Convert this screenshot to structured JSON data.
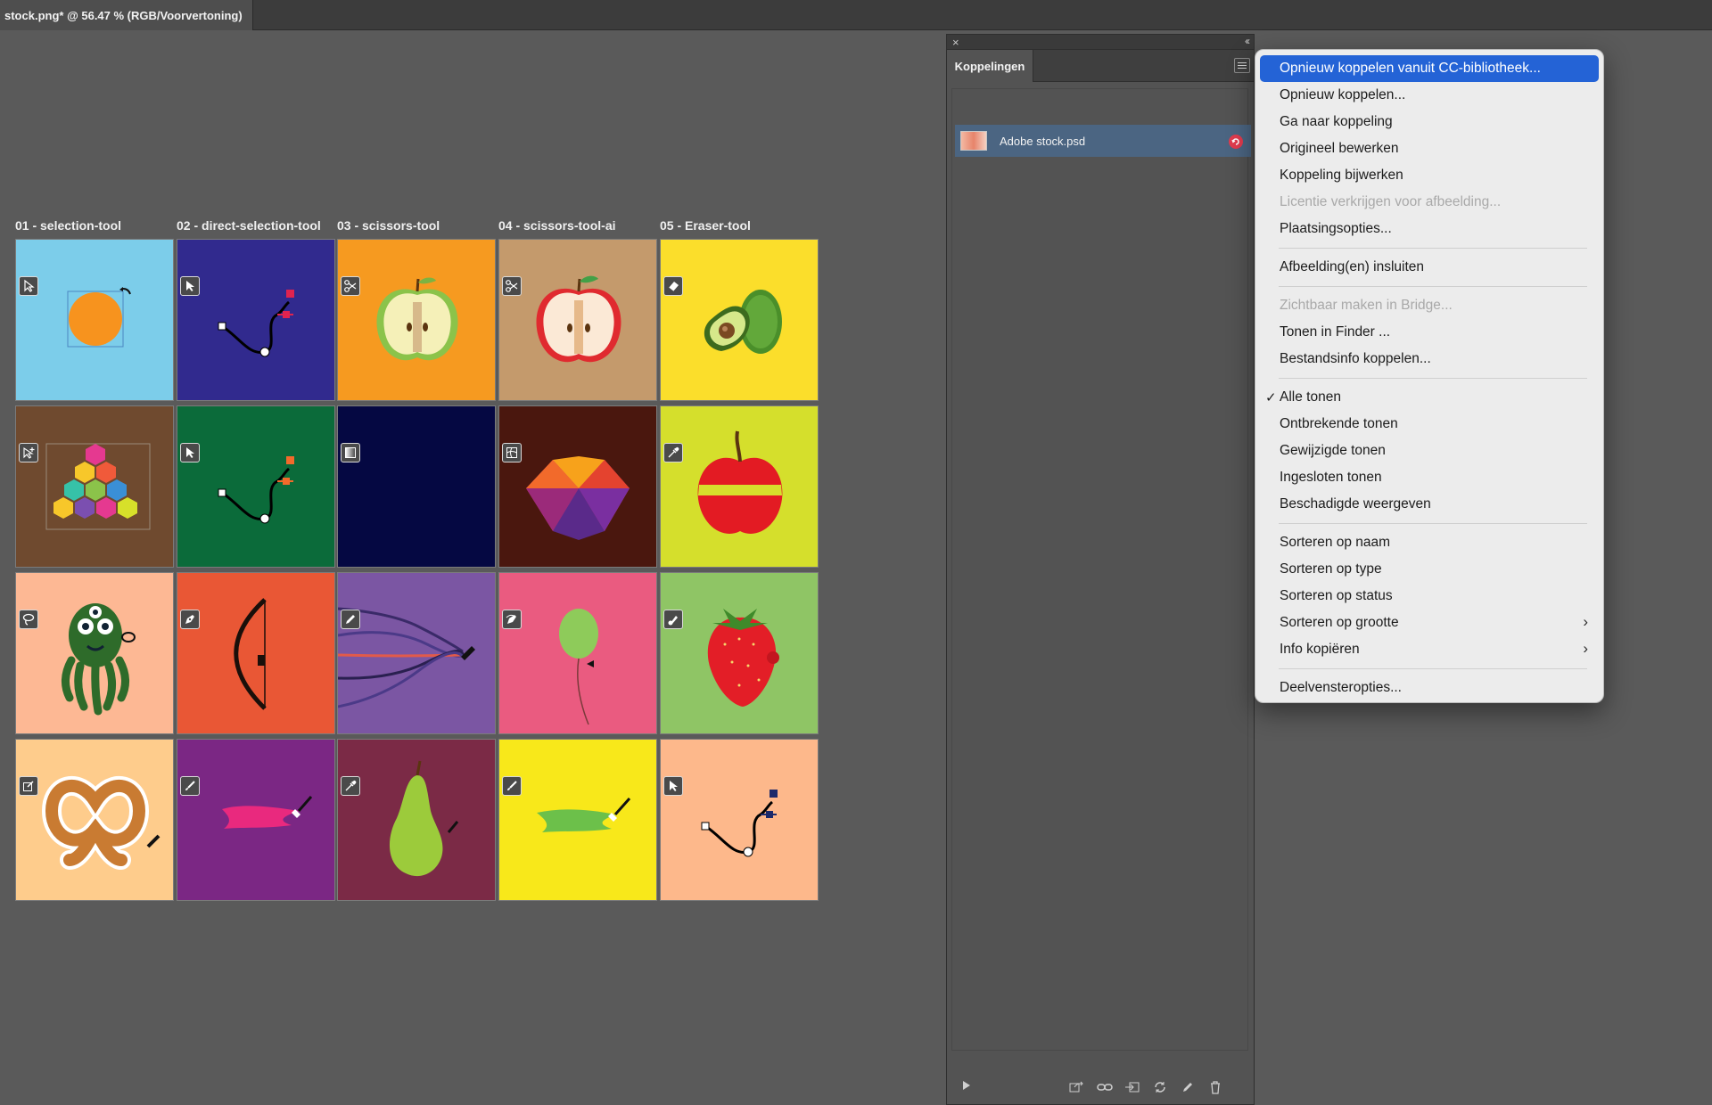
{
  "window": {
    "document_tab_title": "stock.png* @ 56.47 % (RGB/Voorvertoning)"
  },
  "canvas": {
    "column_labels": [
      "01 - selection-tool",
      "02 - direct-selection-tool",
      "03 - scissors-tool",
      "04 - scissors-tool-ai",
      "05 - Eraser-tool"
    ],
    "tile_colors": [
      [
        "#7ccdea",
        "#312a8e",
        "#f69a20",
        "#c49a6c",
        "#fbde2b"
      ],
      [
        "#6f4a2f",
        "#0b6b3a",
        "#050842",
        "#4a170e",
        "#d5df2c"
      ],
      [
        "#fdb894",
        "#e95735",
        "#7b56a3",
        "#ea5b80",
        "#8fc565"
      ],
      [
        "#fecc8c",
        "#7b2784",
        "#7b2a46",
        "#f8e81a",
        "#fdb88b"
      ]
    ]
  },
  "links_panel": {
    "tab_label": "Koppelingen",
    "link_item": {
      "name": "Adobe stock.psd"
    }
  },
  "context_menu": {
    "items": [
      {
        "label": "Opnieuw koppelen vanuit CC-bibliotheek...",
        "state": "active"
      },
      {
        "label": "Opnieuw koppelen...",
        "state": "normal"
      },
      {
        "label": "Ga naar koppeling",
        "state": "normal"
      },
      {
        "label": "Origineel bewerken",
        "state": "normal"
      },
      {
        "label": "Koppeling bijwerken",
        "state": "normal"
      },
      {
        "label": "Licentie verkrijgen voor afbeelding...",
        "state": "disabled"
      },
      {
        "label": "Plaatsingsopties...",
        "state": "normal"
      },
      {
        "label": "Afbeelding(en) insluiten",
        "state": "normal"
      },
      {
        "label": "Zichtbaar maken in Bridge...",
        "state": "disabled"
      },
      {
        "label": "Tonen in Finder ...",
        "state": "normal"
      },
      {
        "label": "Bestandsinfo koppelen...",
        "state": "normal"
      },
      {
        "label": "Alle tonen",
        "state": "checked"
      },
      {
        "label": "Ontbrekende tonen",
        "state": "normal"
      },
      {
        "label": "Gewijzigde tonen",
        "state": "normal"
      },
      {
        "label": "Ingesloten tonen",
        "state": "normal"
      },
      {
        "label": "Beschadigde weergeven",
        "state": "normal"
      },
      {
        "label": "Sorteren op naam",
        "state": "normal"
      },
      {
        "label": "Sorteren op type",
        "state": "normal"
      },
      {
        "label": "Sorteren op status",
        "state": "normal"
      },
      {
        "label": "Sorteren op grootte",
        "state": "submenu"
      },
      {
        "label": "Info kopiëren",
        "state": "submenu"
      },
      {
        "label": "Deelvensteropties...",
        "state": "normal"
      }
    ]
  }
}
